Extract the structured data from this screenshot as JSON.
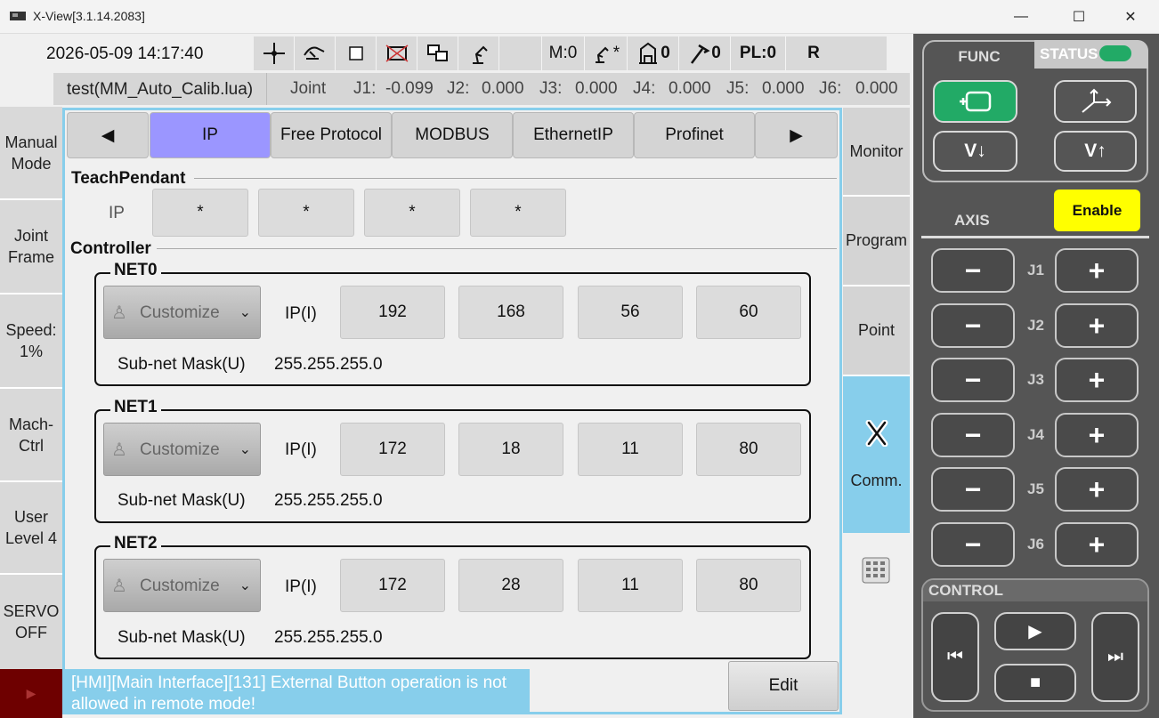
{
  "window": {
    "title": "X-View[3.1.14.2083]",
    "min": "—",
    "max": "☐",
    "close": "✕"
  },
  "status": {
    "datetime": "2026-05-09 14:17:40",
    "m": "M:0",
    "tool_count": "0",
    "user_count": "0",
    "pl": "PL:0",
    "r": "R",
    "tool_star": "*"
  },
  "file": "test(MM_Auto_Calib.lua)",
  "joint": {
    "label": "Joint",
    "values": [
      {
        "n": "J1:",
        "v": "-0.099"
      },
      {
        "n": "J2:",
        "v": "0.000"
      },
      {
        "n": "J3:",
        "v": "0.000"
      },
      {
        "n": "J4:",
        "v": "0.000"
      },
      {
        "n": "J5:",
        "v": "0.000"
      },
      {
        "n": "J6:",
        "v": "0.000"
      }
    ]
  },
  "left": {
    "manual": "Manual Mode",
    "joint_frame": "Joint Frame",
    "speed": "Speed: 1%",
    "mach": "Mach- Ctrl",
    "user": "User Level 4",
    "servo": "SERVO OFF"
  },
  "tabs": {
    "prev": "◀",
    "ip": "IP",
    "free": "Free Protocol",
    "modbus": "MODBUS",
    "ethernetip": "EthernetIP",
    "profinet": "Profinet",
    "next": "▶"
  },
  "teach": {
    "title": "TeachPendant",
    "ip_label": "IP",
    "octets": [
      "*",
      "*",
      "*",
      "*"
    ]
  },
  "controller": {
    "title": "Controller",
    "nets": [
      {
        "name": "NET0",
        "combo": "Customize",
        "ip_label": "IP(I)",
        "octets": [
          "192",
          "168",
          "56",
          "60"
        ],
        "mask_label": "Sub-net Mask(U)",
        "mask": "255.255.255.0"
      },
      {
        "name": "NET1",
        "combo": "Customize",
        "ip_label": "IP(I)",
        "octets": [
          "172",
          "18",
          "11",
          "80"
        ],
        "mask_label": "Sub-net Mask(U)",
        "mask": "255.255.255.0"
      },
      {
        "name": "NET2",
        "combo": "Customize",
        "ip_label": "IP(I)",
        "octets": [
          "172",
          "28",
          "11",
          "80"
        ],
        "mask_label": "Sub-net Mask(U)",
        "mask": "255.255.255.0"
      }
    ]
  },
  "message": "[HMI][Main Interface][131] External Button operation is not allowed in remote mode!",
  "edit": "Edit",
  "right_tabs": {
    "monitor": "Monitor",
    "program": "Program",
    "point": "Point",
    "comm": "Comm."
  },
  "panel": {
    "func": "FUNC",
    "status": "STATUS",
    "v_down": "V↓",
    "v_up": "V↑",
    "axis": "AXIS",
    "enable": "Enable",
    "control": "CONTROL",
    "minus": "−",
    "plus": "+",
    "joints": [
      "J1",
      "J2",
      "J3",
      "J4",
      "J5",
      "J6"
    ]
  },
  "colors": {
    "accent_blue": "#87ceeb",
    "active_tab": "#9b96ff",
    "enable": "#ffff00",
    "status_green": "#22aa66"
  }
}
